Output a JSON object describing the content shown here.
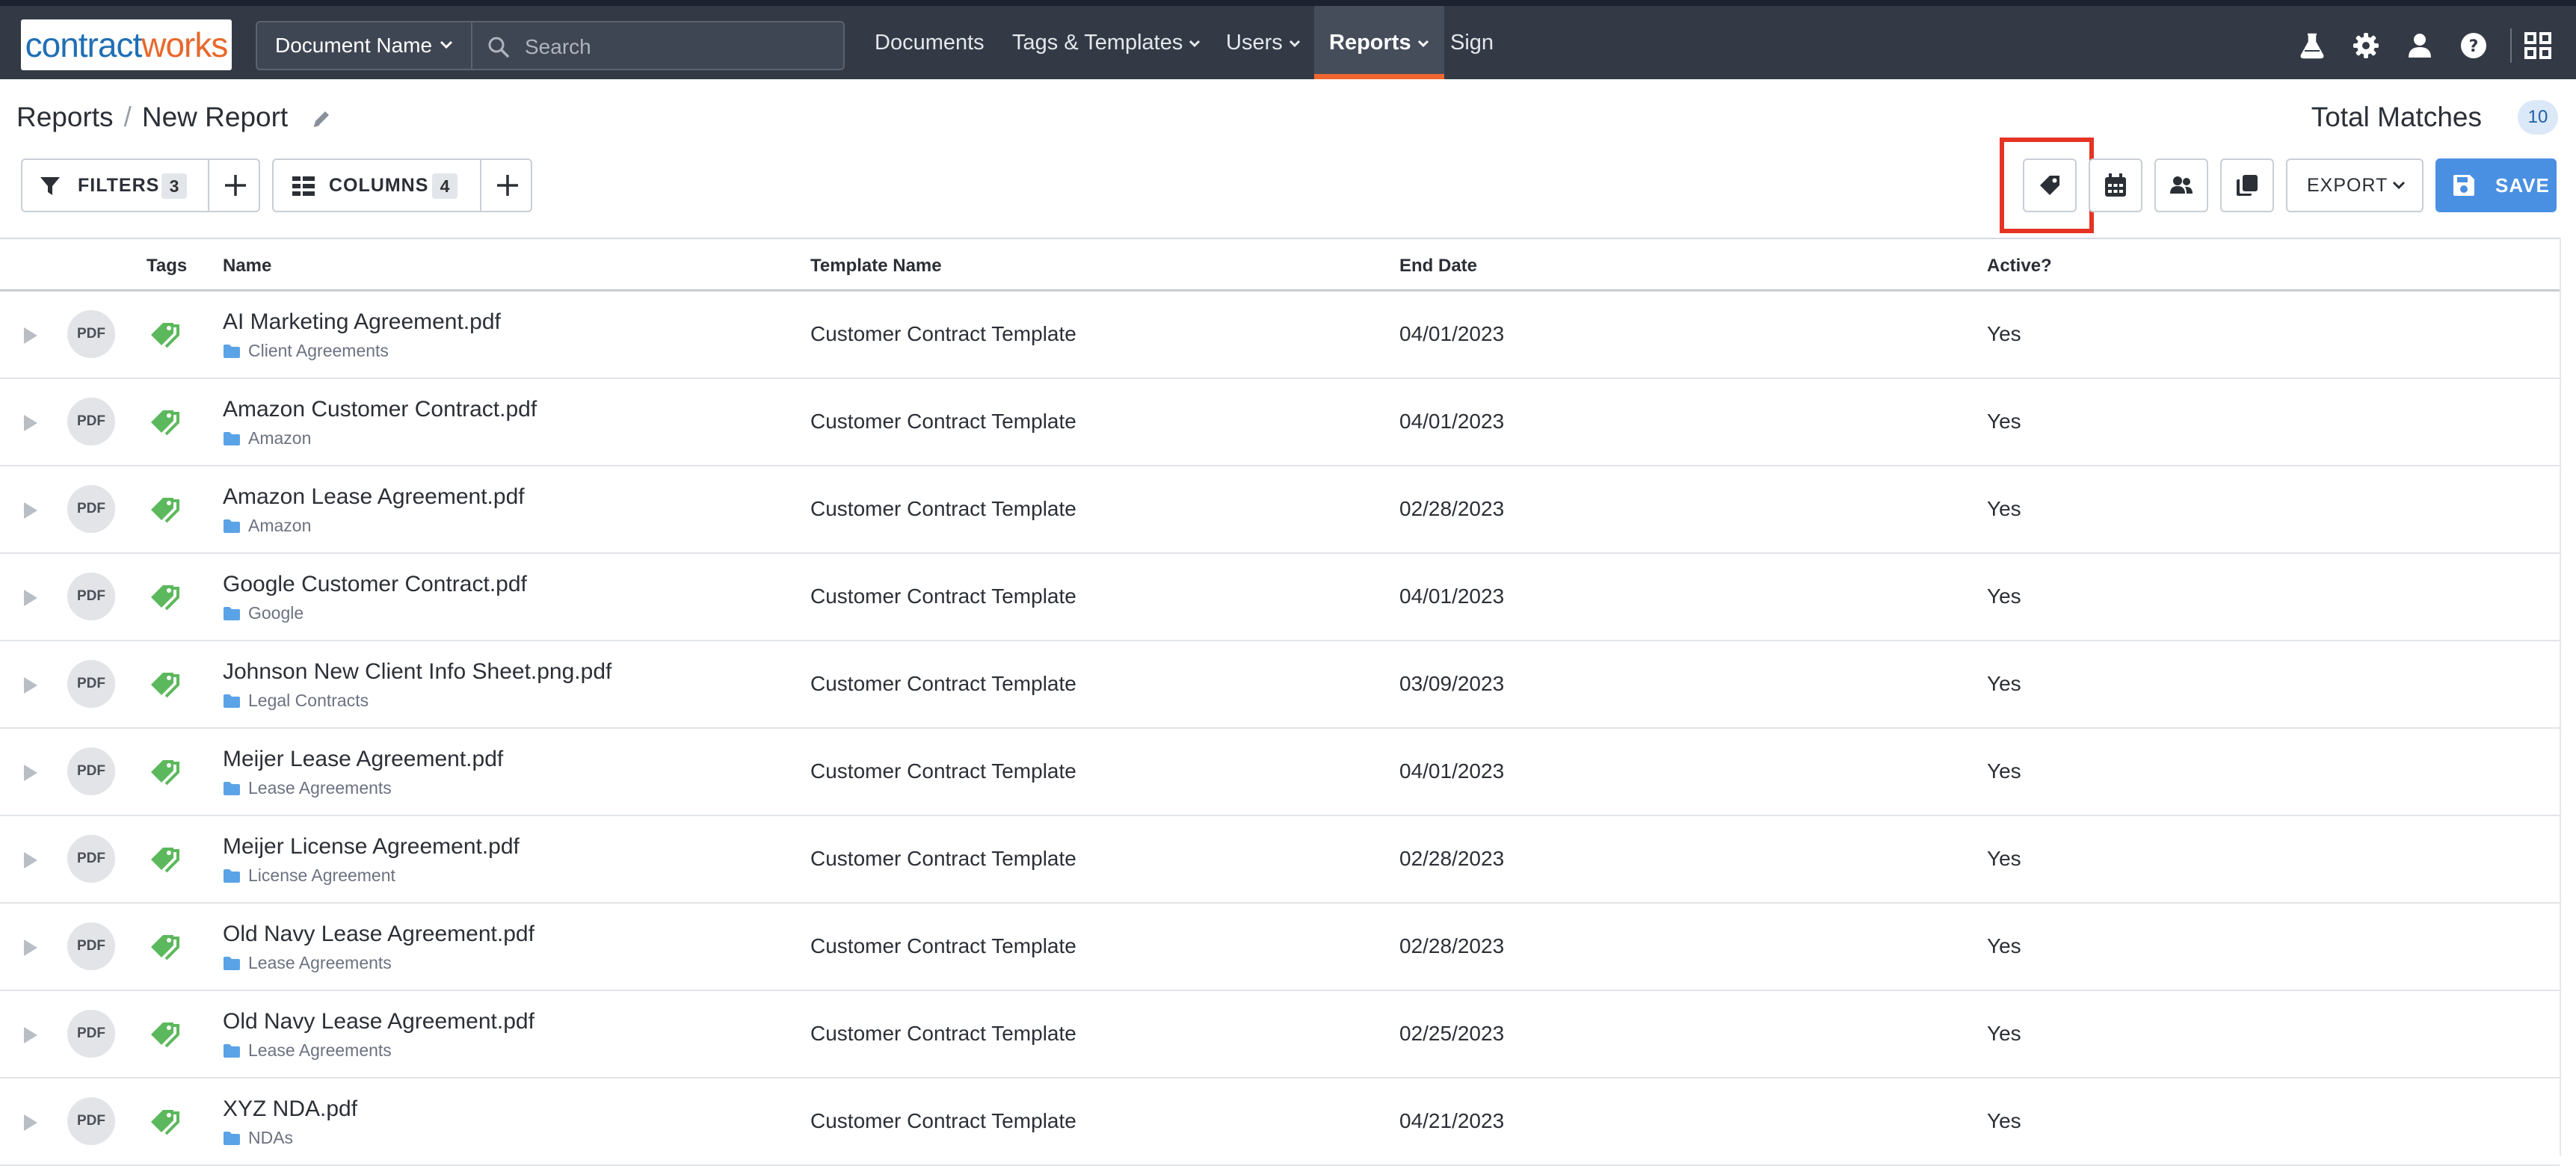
{
  "brand": {
    "logo_part1": "contract",
    "logo_part2": "works",
    "accent": "#f0662e",
    "nav_bg": "#333a46",
    "primary": "#4a90e2",
    "tag_green": "#5cb85c",
    "highlight": "#e53424"
  },
  "nav": {
    "doc_selector": "Document Name",
    "search_placeholder": "Search",
    "items": [
      {
        "label": "Documents",
        "has_caret": false
      },
      {
        "label": "Tags & Templates",
        "has_caret": true
      },
      {
        "label": "Users",
        "has_caret": true
      },
      {
        "label": "Reports",
        "has_caret": true,
        "active": true
      },
      {
        "label": "Sign",
        "has_caret": false
      }
    ],
    "right_icons": [
      "flask-icon",
      "gear-icon",
      "user-icon",
      "help-icon",
      "apps-grid-icon"
    ]
  },
  "header": {
    "breadcrumb_root": "Reports",
    "breadcrumb_separator": "/",
    "breadcrumb_current": "New Report",
    "total_label": "Total Matches",
    "total_count": "10"
  },
  "toolbar": {
    "filters_label": "FILTERS",
    "filters_count": "3",
    "columns_label": "COLUMNS",
    "columns_count": "4",
    "right_icons": [
      "tag-icon",
      "calendar-icon",
      "users-icon",
      "copy-icon"
    ],
    "export_label": "EXPORT",
    "save_label": "SAVE"
  },
  "table": {
    "columns": [
      "Tags",
      "Name",
      "Template Name",
      "End Date",
      "Active?"
    ],
    "file_badge": "PDF",
    "rows": [
      {
        "name": "AI Marketing Agreement.pdf",
        "folder": "Client Agreements",
        "template": "Customer Contract Template",
        "end_date": "04/01/2023",
        "active": "Yes"
      },
      {
        "name": "Amazon Customer Contract.pdf",
        "folder": "Amazon",
        "template": "Customer Contract Template",
        "end_date": "04/01/2023",
        "active": "Yes"
      },
      {
        "name": "Amazon Lease Agreement.pdf",
        "folder": "Amazon",
        "template": "Customer Contract Template",
        "end_date": "02/28/2023",
        "active": "Yes"
      },
      {
        "name": "Google Customer Contract.pdf",
        "folder": "Google",
        "template": "Customer Contract Template",
        "end_date": "04/01/2023",
        "active": "Yes"
      },
      {
        "name": "Johnson New Client Info Sheet.png.pdf",
        "folder": "Legal Contracts",
        "template": "Customer Contract Template",
        "end_date": "03/09/2023",
        "active": "Yes"
      },
      {
        "name": "Meijer Lease Agreement.pdf",
        "folder": "Lease Agreements",
        "template": "Customer Contract Template",
        "end_date": "04/01/2023",
        "active": "Yes"
      },
      {
        "name": "Meijer License Agreement.pdf",
        "folder": "License Agreement",
        "template": "Customer Contract Template",
        "end_date": "02/28/2023",
        "active": "Yes"
      },
      {
        "name": "Old Navy Lease Agreement.pdf",
        "folder": "Lease Agreements",
        "template": "Customer Contract Template",
        "end_date": "02/28/2023",
        "active": "Yes"
      },
      {
        "name": "Old Navy Lease Agreement.pdf",
        "folder": "Lease Agreements",
        "template": "Customer Contract Template",
        "end_date": "02/25/2023",
        "active": "Yes"
      },
      {
        "name": "XYZ NDA.pdf",
        "folder": "NDAs",
        "template": "Customer Contract Template",
        "end_date": "04/21/2023",
        "active": "Yes"
      }
    ]
  }
}
